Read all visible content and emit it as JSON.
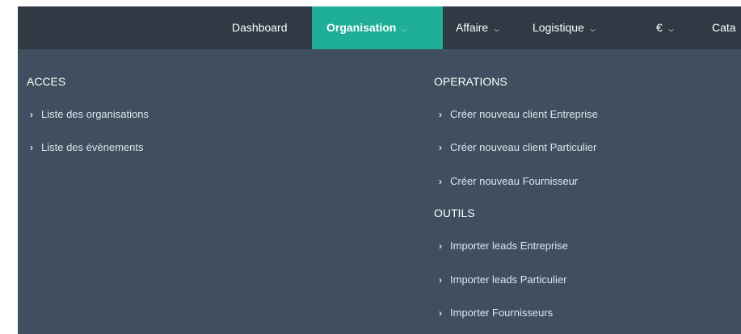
{
  "navbar": {
    "items": [
      {
        "label": "Dashboard",
        "has_dropdown": false
      },
      {
        "label": "Organisation",
        "has_dropdown": true,
        "active": true
      },
      {
        "label": "Affaire",
        "has_dropdown": true
      },
      {
        "label": "Logistique",
        "has_dropdown": true
      },
      {
        "label": "€",
        "has_dropdown": true
      },
      {
        "label": "Cata",
        "has_dropdown": false
      }
    ],
    "chevron_icon": "chevron-down-icon",
    "active_color": "#1fae98",
    "background_color": "#2f3a45"
  },
  "dropdown": {
    "background_color": "#3f4f5f",
    "item_icon": "chevron-right-icon",
    "acces": {
      "title": "ACCES",
      "items": [
        "Liste des organisations",
        "Liste des évènements"
      ]
    },
    "operations": {
      "title": "OPERATIONS",
      "items": [
        "Créer nouveau client Entreprise",
        "Créer nouveau client Particulier",
        "Créer nouveau Fournisseur"
      ]
    },
    "outils": {
      "title": "OUTILS",
      "items": [
        "Importer leads Entreprise",
        "Importer leads Particulier",
        "Importer Fournisseurs"
      ]
    }
  }
}
